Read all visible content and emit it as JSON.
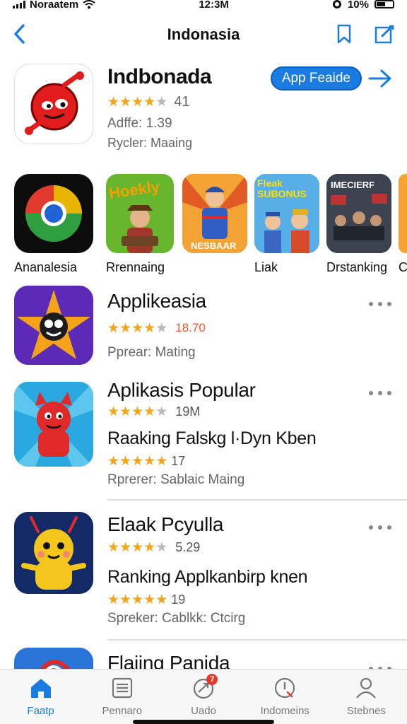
{
  "status": {
    "carrier": "Noraatem",
    "time": "12:3M",
    "battery": "10%"
  },
  "nav": {
    "title": "Indonasia",
    "back_icon": "chevron-left-icon",
    "bookmark_icon": "bookmark-icon",
    "edit_icon": "edit-icon"
  },
  "featured": {
    "name": "Indbonada",
    "rating": 3.5,
    "rating_count": "41",
    "line1": "Adffe: 1.39",
    "line2": "Rycler: Maaing",
    "button_label": "App Feaide"
  },
  "carousel": [
    {
      "label": "Ananalesia",
      "icon": "chrome-style-icon"
    },
    {
      "label": "Rrennaing",
      "icon": "game-art-icon",
      "art_text": "Hoekly"
    },
    {
      "label": "",
      "icon": "game-art-icon",
      "art_text": "NESBAAR"
    },
    {
      "label": "Liak",
      "icon": "game-art-icon",
      "art_text": "Fleak SUBONUS"
    },
    {
      "label": "Drstanking",
      "icon": "game-art-icon",
      "art_text": "IMECIERF"
    },
    {
      "label": "C",
      "icon": "game-art-icon"
    }
  ],
  "list": [
    {
      "title": "Applikeasia",
      "rating": 3.5,
      "rating_text": "18.70",
      "subtitle": "",
      "sub_rating": null,
      "sub_rating_text": "",
      "meta": "Pprear: Mating"
    },
    {
      "title": "Aplikasis Popular",
      "rating": 4,
      "rating_text": "19M",
      "subtitle": "Raaking Falskg l·Dyn Kben",
      "sub_rating": 4.5,
      "sub_rating_text": "17",
      "meta": "Rprerer: Sablaic Maing"
    },
    {
      "title": "Elaak Pcyulla",
      "rating": 4,
      "rating_text": "5.29",
      "subtitle": "Ranking Applkanbirp knen",
      "sub_rating": 4.5,
      "sub_rating_text": "19",
      "meta": "Spreker: Cablkk: Ctcirg"
    },
    {
      "title": "Flaiing Panida",
      "rating": null,
      "rating_text": "",
      "subtitle": "",
      "sub_rating": null,
      "sub_rating_text": "",
      "meta": ""
    }
  ],
  "tabs": [
    {
      "label": "Faatp",
      "icon": "home-icon",
      "active": true
    },
    {
      "label": "Pennaro",
      "icon": "list-icon",
      "active": false
    },
    {
      "label": "Uado",
      "icon": "updates-icon",
      "active": false,
      "badge": "7"
    },
    {
      "label": "Indomeins",
      "icon": "info-icon",
      "active": false
    },
    {
      "label": "Stebnes",
      "icon": "person-icon",
      "active": false
    }
  ],
  "colors": {
    "accent": "#1a7be0",
    "star": "#f2a51a",
    "badge": "#e23a2a"
  }
}
